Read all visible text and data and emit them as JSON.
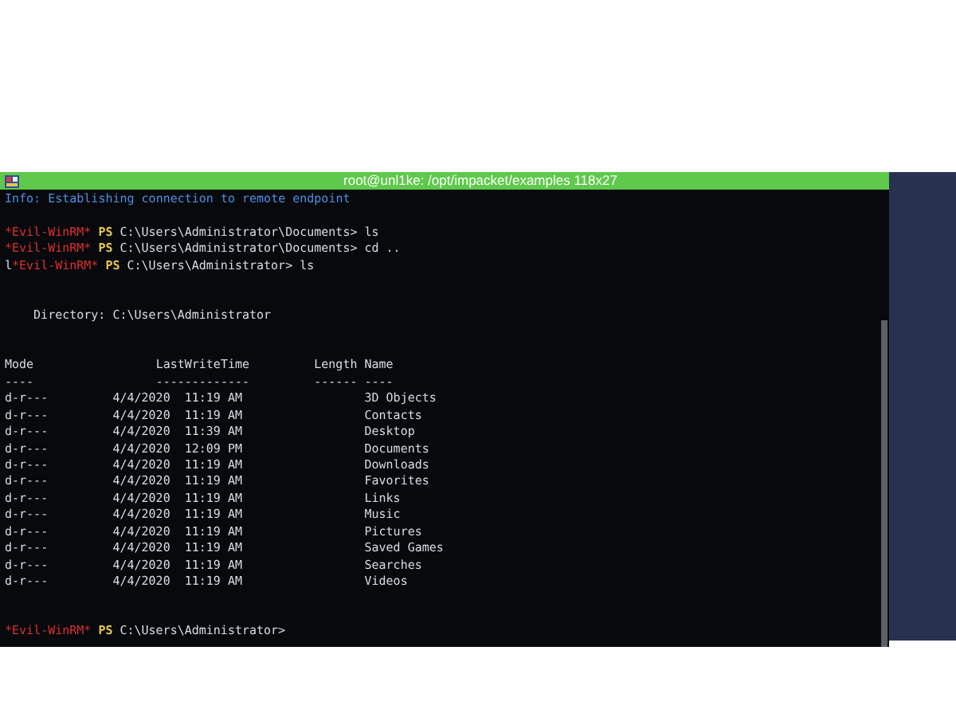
{
  "window": {
    "title": "root@unl1ke: /opt/impacket/examples 118x27"
  },
  "info": "Info: Establishing connection to remote endpoint",
  "commands": [
    {
      "tag": "*Evil-WinRM*",
      "ps": "PS",
      "path": "C:\\Users\\Administrator\\Documents>",
      "command": "ls"
    },
    {
      "tag": "*Evil-WinRM*",
      "ps": "PS",
      "path": "C:\\Users\\Administrator\\Documents>",
      "command": "cd .."
    },
    {
      "prefix": "l",
      "tag": "*Evil-WinRM*",
      "ps": "PS",
      "path": "C:\\Users\\Administrator>",
      "command": "ls"
    }
  ],
  "directory": "Directory: C:\\Users\\Administrator",
  "table": {
    "columns": [
      {
        "label": "Mode",
        "rule": "----"
      },
      {
        "label": "LastWriteTime",
        "rule": "-------------"
      },
      {
        "label": "Length",
        "rule": "------"
      },
      {
        "label": "Name",
        "rule": "----"
      }
    ],
    "rows": [
      {
        "mode": "d-r---",
        "last_write_time": "4/4/2020  11:19 AM",
        "name": "3D Objects"
      },
      {
        "mode": "d-r---",
        "last_write_time": "4/4/2020  11:19 AM",
        "name": "Contacts"
      },
      {
        "mode": "d-r---",
        "last_write_time": "4/4/2020  11:39 AM",
        "name": "Desktop"
      },
      {
        "mode": "d-r---",
        "last_write_time": "4/4/2020  12:09 PM",
        "name": "Documents"
      },
      {
        "mode": "d-r---",
        "last_write_time": "4/4/2020  11:19 AM",
        "name": "Downloads"
      },
      {
        "mode": "d-r---",
        "last_write_time": "4/4/2020  11:19 AM",
        "name": "Favorites"
      },
      {
        "mode": "d-r---",
        "last_write_time": "4/4/2020  11:19 AM",
        "name": "Links"
      },
      {
        "mode": "d-r---",
        "last_write_time": "4/4/2020  11:19 AM",
        "name": "Music"
      },
      {
        "mode": "d-r---",
        "last_write_time": "4/4/2020  11:19 AM",
        "name": "Pictures"
      },
      {
        "mode": "d-r---",
        "last_write_time": "4/4/2020  11:19 AM",
        "name": "Saved Games"
      },
      {
        "mode": "d-r---",
        "last_write_time": "4/4/2020  11:19 AM",
        "name": "Searches"
      },
      {
        "mode": "d-r---",
        "last_write_time": "4/4/2020  11:19 AM",
        "name": "Videos"
      }
    ]
  },
  "final_prompt": {
    "tag": "*Evil-WinRM*",
    "ps": "PS",
    "path": "C:\\Users\\Administrator>"
  }
}
